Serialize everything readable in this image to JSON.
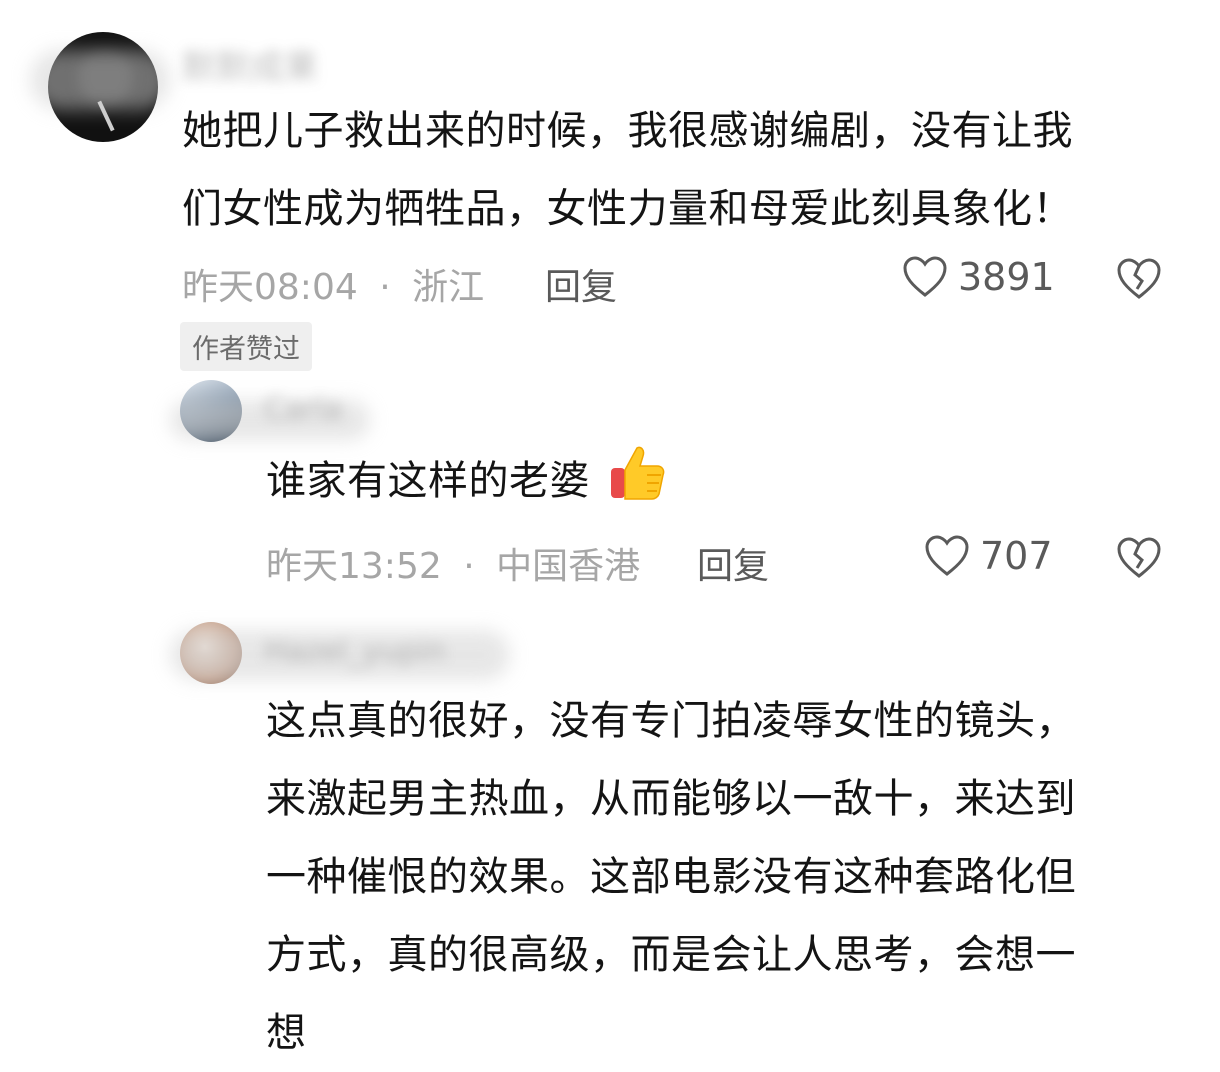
{
  "comments": [
    {
      "username": "默默成果",
      "text_lines": [
        "她把儿子救出来的时候，我很感谢编剧，没有让我",
        "们女性成为牺牲品，女性力量和母爱此刻具象化！"
      ],
      "time": "昨天08:04",
      "separator": "·",
      "location": "浙江",
      "reply_label": "回复",
      "likes": "3891",
      "badge": "作者赞过",
      "like_icon": "heart-outline-icon",
      "dislike_icon": "broken-heart-icon"
    },
    {
      "username": "Carla",
      "text": "谁家有这样的老婆",
      "emoji": "thumbs-up-emoji",
      "time": "昨天13:52",
      "separator": "·",
      "location": "中国香港",
      "reply_label": "回复",
      "likes": "707",
      "like_icon": "heart-outline-icon",
      "dislike_icon": "broken-heart-icon"
    },
    {
      "username": "Hazel_yupin",
      "text_lines": [
        "这点真的很好，没有专门拍凌辱女性的镜头，",
        "来激起男主热血，从而能够以一敌十，来达到",
        "一种催恨的效果。这部电影没有这种套路化但",
        "方式，真的很高级，而是会让人思考，会想一",
        "想"
      ]
    }
  ],
  "colors": {
    "text": "#141414",
    "meta": "#a6a6a6",
    "badge_bg": "#efefef"
  }
}
